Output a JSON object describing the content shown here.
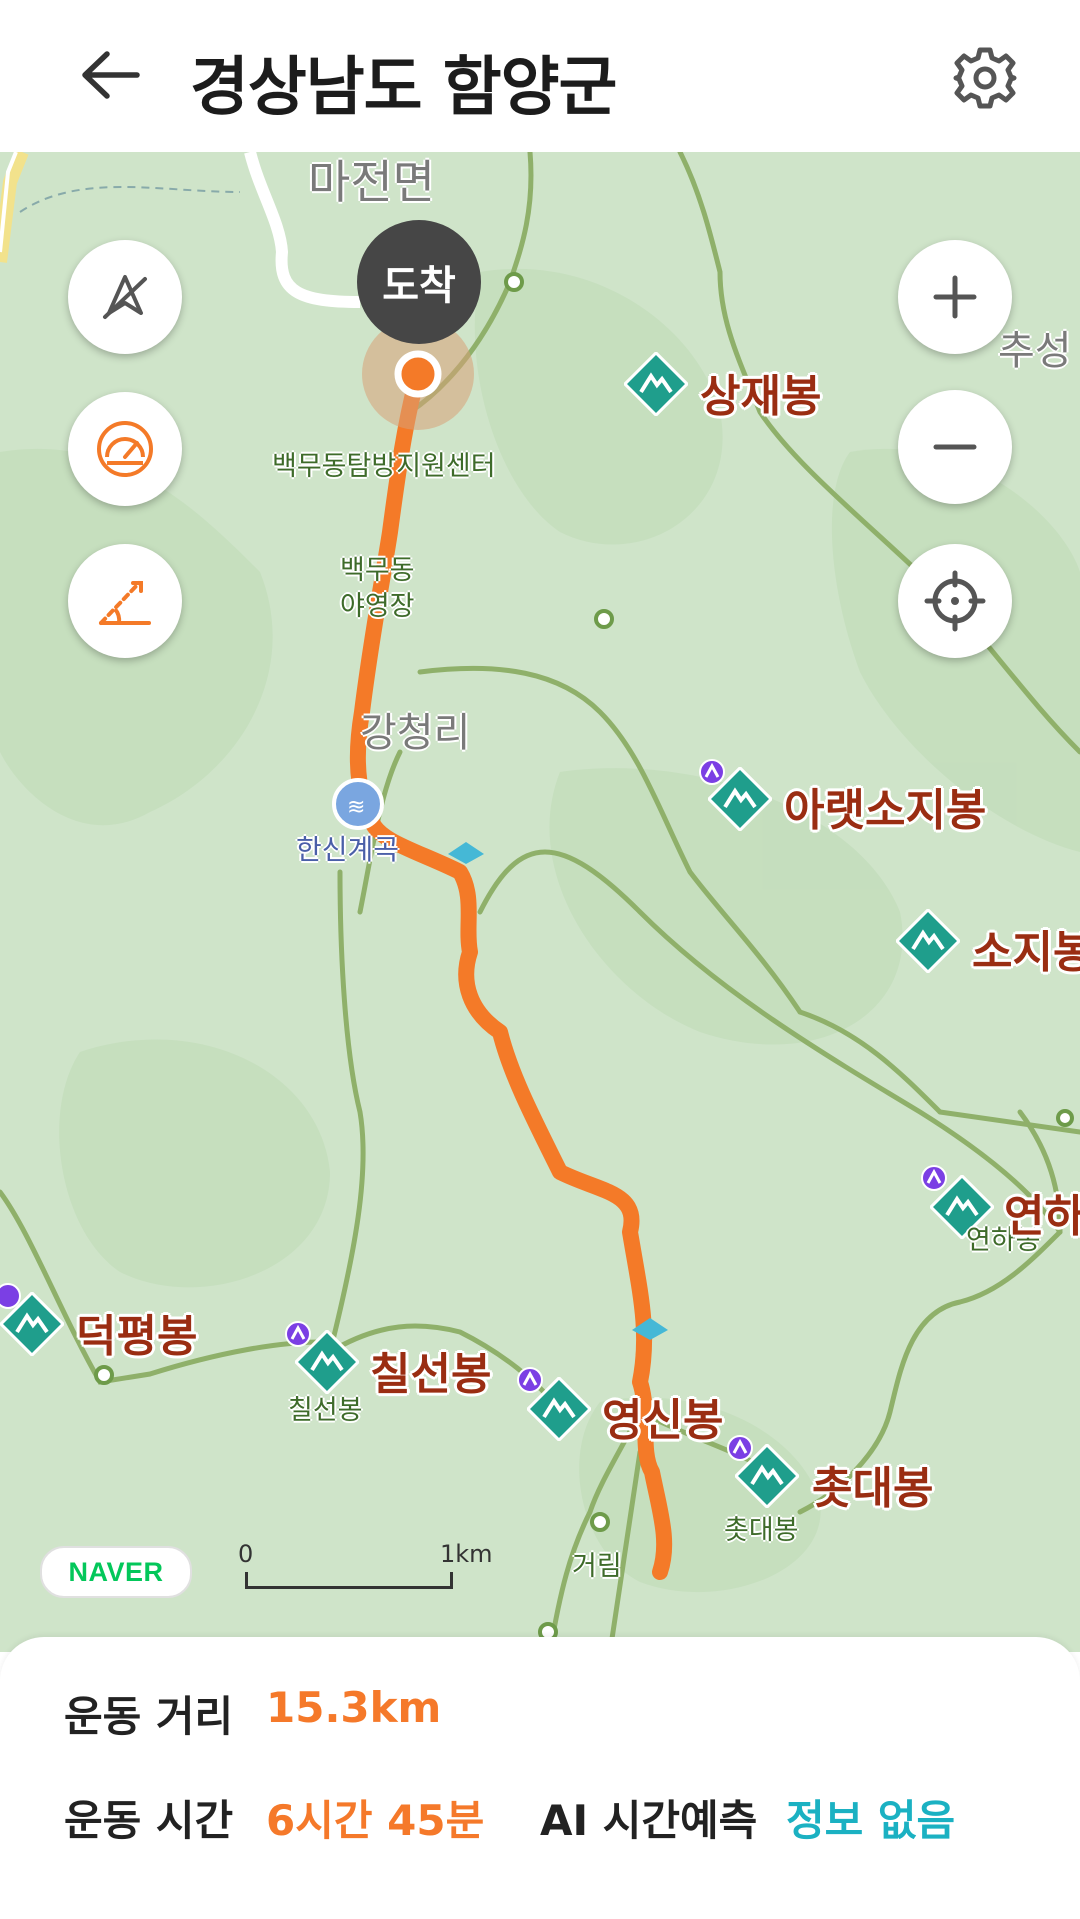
{
  "header": {
    "title": "경상남도 함양군"
  },
  "map": {
    "arrival_label": "도착",
    "town_labels": [
      "마전면",
      "강청리",
      "추성"
    ],
    "place_labels": [
      "백무동탐방지원센터",
      "백무동",
      "야영장",
      "칠선봉",
      "영신봉",
      "촛대봉",
      "연하봉",
      "거림"
    ],
    "stream_label": "한신계곡",
    "peaks": [
      "상재봉",
      "아랫소지봉",
      "소지봉",
      "덕평봉",
      "칠선봉",
      "영신봉",
      "촛대봉",
      "연하"
    ],
    "attribution": "NAVER",
    "scale": {
      "start": "0",
      "end": "1km"
    },
    "colors": {
      "route": "#f47a28",
      "peak_marker": "#1f9e8c",
      "road": "#8fb06a"
    }
  },
  "map_controls": {
    "left": [
      "compass-off-icon",
      "speedometer-icon",
      "elevation-icon"
    ],
    "right": [
      "zoom-in-icon",
      "zoom-out-icon",
      "locate-icon"
    ]
  },
  "stats": {
    "distance_label": "운동 거리",
    "distance_value": "15.3km",
    "time_label": "운동 시간",
    "time_value": "6시간 45분",
    "ai_label": "AI 시간예측",
    "ai_value": "정보 없음"
  }
}
